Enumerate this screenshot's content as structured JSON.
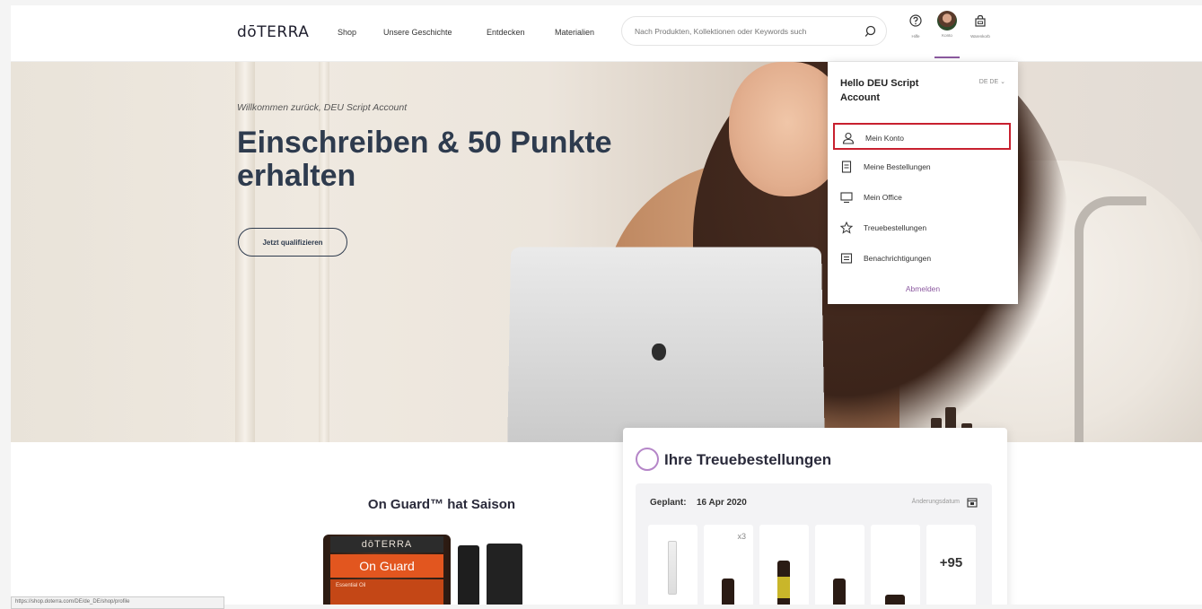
{
  "header": {
    "logo": "dōTERRA",
    "nav": [
      "Shop",
      "Unsere Geschichte",
      "Entdecken",
      "Materialien"
    ],
    "search_placeholder": "Nach Produkten, Kollektionen oder Keywords such",
    "help_label": "Hilfe",
    "account_label": "Konto",
    "cart_label": "Warenkorb",
    "icons": {
      "search": "search-icon",
      "help": "help-icon",
      "cart": "cart-icon"
    }
  },
  "hero": {
    "welcome": "Willkommen zurück, DEU Script Account",
    "headline": "Einschreiben & 50 Punkte erhalten",
    "cta": "Jetzt qualifizieren"
  },
  "account_menu": {
    "greeting": "Hello DEU Script Account",
    "locale": "DE DE",
    "items": [
      {
        "label": "Mein Konto",
        "icon": "user-icon"
      },
      {
        "label": "Meine Bestellungen",
        "icon": "orders-icon"
      },
      {
        "label": "Mein Office",
        "icon": "monitor-icon"
      },
      {
        "label": "Treuebestellungen",
        "icon": "star-icon"
      },
      {
        "label": "Benachrichtigungen",
        "icon": "notifications-icon"
      }
    ],
    "logout": "Abmelden"
  },
  "promo": {
    "title": "On Guard™ hat Saison",
    "bottle_brand": "dōTERRA",
    "bottle_name": "On Guard",
    "bottle_sub": "Essential Oil"
  },
  "loyalty": {
    "title": "Ihre Treuebestellungen",
    "planned_label": "Geplant:",
    "planned_date": "16 Apr 2020",
    "change_date_label": "Änderungsdatum",
    "first_qty": "x3",
    "more_count": "+95"
  },
  "status_bar": {
    "url": "https://shop.doterra.com/DE/de_DE/shop/profile"
  },
  "colors": {
    "accent": "#8c5aa0",
    "highlight": "#c8202f",
    "headline": "#2e3b4e"
  }
}
